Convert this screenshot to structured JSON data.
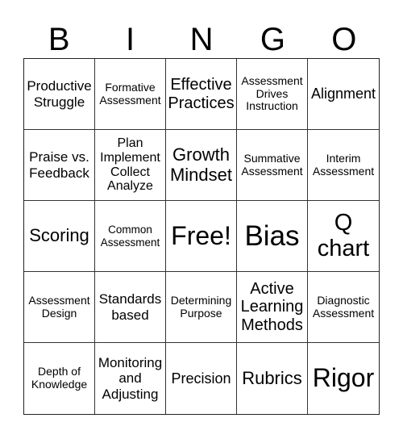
{
  "header": {
    "letters": [
      "B",
      "I",
      "N",
      "G",
      "O"
    ]
  },
  "cells": [
    "Productive\nStruggle",
    "Formative\nAssessment",
    "Effective\nPractices",
    "Assessment\nDrives\nInstruction",
    "Alignment",
    "Praise vs.\nFeedback",
    "Plan\nImplement\nCollect\nAnalyze",
    "Growth\nMindset",
    "Summative\nAssessment",
    "Interim\nAssessment",
    "Scoring",
    "Common\nAssessment",
    "Free!",
    "Bias",
    "Q\nchart",
    "Assessment\nDesign",
    "Standards\nbased",
    "Determining\nPurpose",
    "Active\nLearning\nMethods",
    "Diagnostic\nAssessment",
    "Depth of\nKnowledge",
    "Monitoring\nand\nAdjusting",
    "Precision",
    "Rubrics",
    "Rigor"
  ]
}
